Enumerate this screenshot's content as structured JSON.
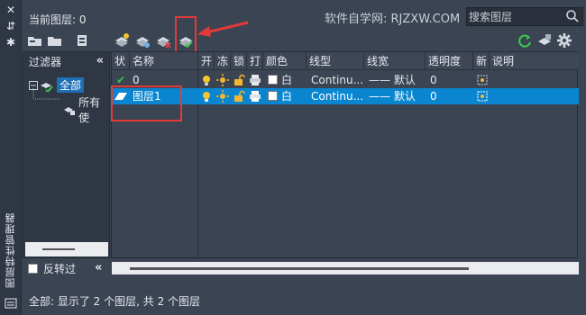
{
  "window": {
    "title": "图层特性管理器"
  },
  "header": {
    "current_layer": "当前图层: 0",
    "watermark": "软件自学网: RJZXW.COM",
    "search_placeholder": "搜索图层"
  },
  "filters": {
    "title": "过滤器",
    "root_label": "全部",
    "child_label": "所有使"
  },
  "columns": [
    "状",
    "名称",
    "开",
    "冻",
    "锁",
    "打",
    "颜色",
    "线型",
    "线宽",
    "透明度",
    "新",
    "说明"
  ],
  "layers": [
    {
      "status": "✔",
      "name": "0",
      "color": "白",
      "linetype": "Continu...",
      "lineweight": "—— 默认",
      "transparency": "0"
    },
    {
      "status": "▰",
      "name": "图层1",
      "color": "白",
      "linetype": "Continu...",
      "lineweight": "—— 默认",
      "transparency": "0"
    }
  ],
  "footer": {
    "invert_label": "反转过",
    "status_text": "全部: 显示了 2 个图层, 共 2 个图层"
  },
  "colors": {
    "panel_bg": "#3b4453",
    "selection": "#0a86d1",
    "highlight_box": "#e23a3a",
    "accent_green": "#3cc34a",
    "lightbulb": "#f3c530",
    "sun": "#f2b630"
  }
}
